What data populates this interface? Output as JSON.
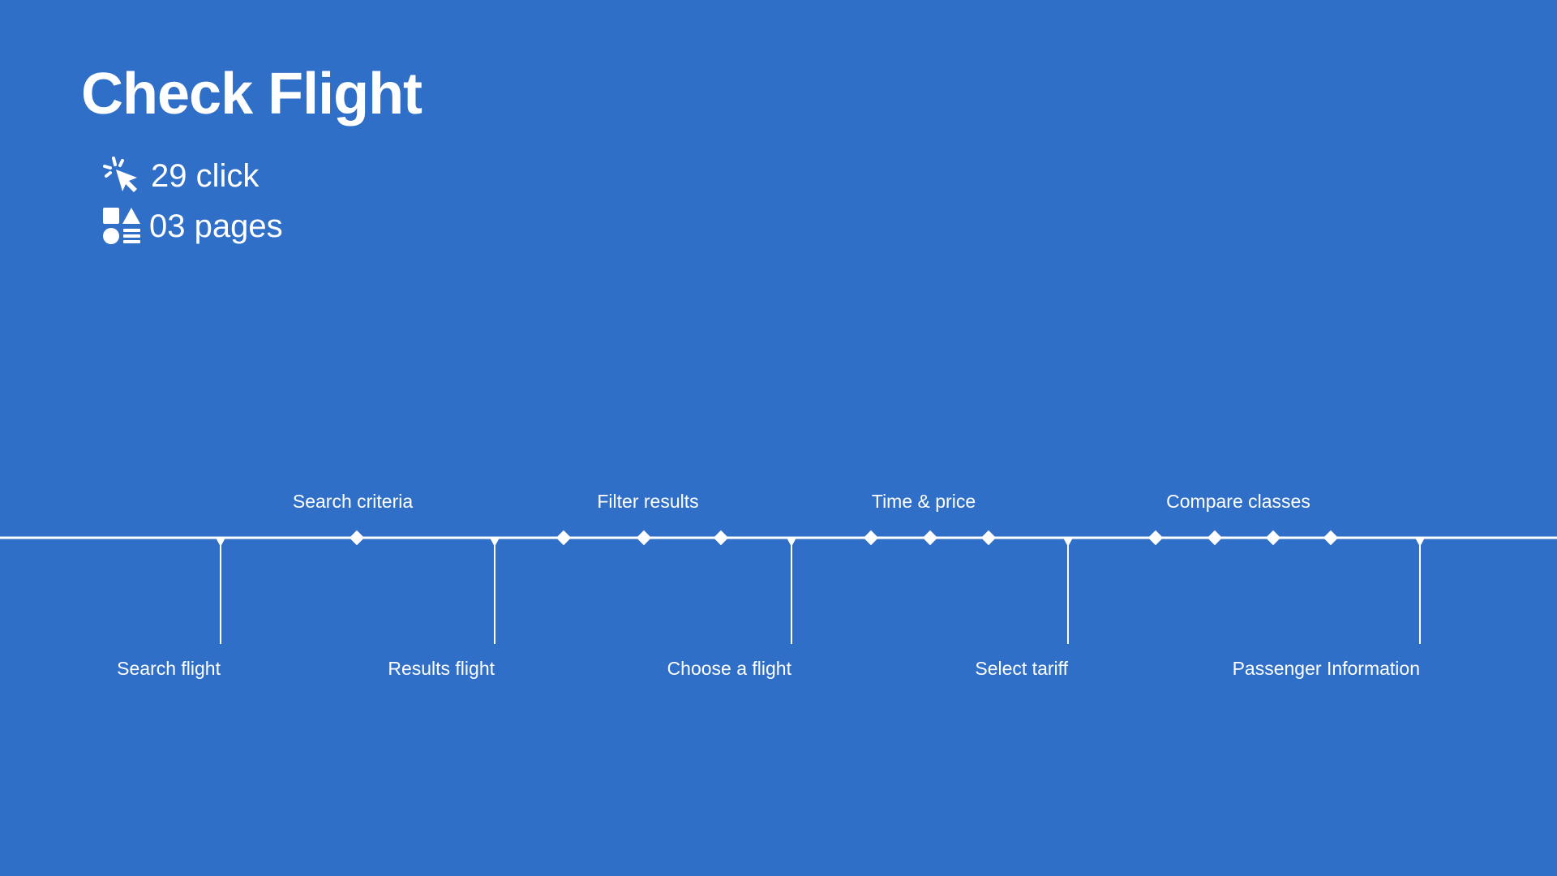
{
  "title": "Check Flight",
  "stats": {
    "clicks_label": "29 click",
    "pages_label": "03 pages",
    "clicks_icon": "cursor-click-icon",
    "pages_icon": "shapes-icon"
  },
  "colors": {
    "background": "#2f6fc8",
    "foreground": "#ffffff"
  },
  "pages": [
    "Search flight",
    "Results flight",
    "Choose a flight",
    "Select tariff",
    "Passenger Information"
  ],
  "interactions": [
    {
      "label": "Search criteria",
      "clicks": 1
    },
    {
      "label": "Filter results",
      "clicks": 3
    },
    {
      "label": "Time & price",
      "clicks": 3
    },
    {
      "label": "Compare classes",
      "clicks": 4
    }
  ]
}
